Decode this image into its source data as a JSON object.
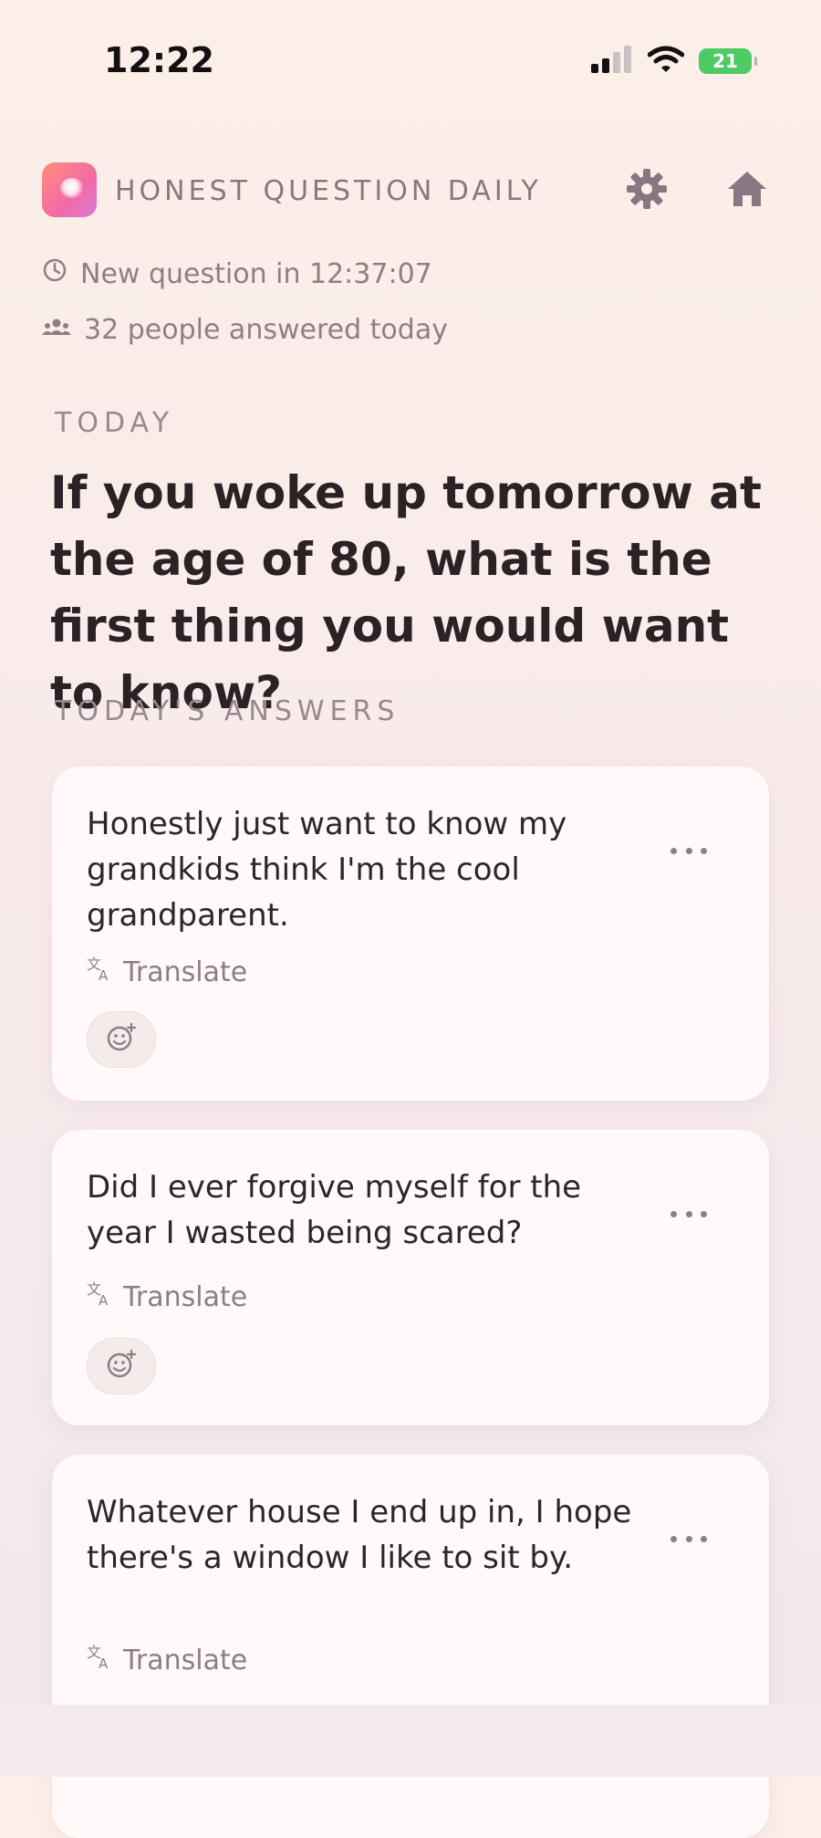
{
  "status_bar": {
    "time": "12:22",
    "battery": "21"
  },
  "header": {
    "title": "HONEST QUESTION DAILY"
  },
  "meta": {
    "countdown": "New question in 12:37:07",
    "answered": "32 people answered today"
  },
  "today": {
    "label": "TODAY",
    "question": "If you woke up tomorrow at the age of 80, what is the first thing you would want to know?"
  },
  "answers": {
    "label": "TODAY'S ANSWERS",
    "translate_label": "Translate",
    "items": [
      {
        "text": "Honestly just want to know my grandkids think I'm the cool grandparent."
      },
      {
        "text": "Did I ever forgive myself for the year I wasted being scared?"
      },
      {
        "text": "Whatever house I end up in, I hope there's a window I like to sit by."
      }
    ]
  },
  "colors": {
    "accent": "#8a7681",
    "logo_gradient": [
      "#ff8d7a",
      "#f36aa6",
      "#d97bd4"
    ],
    "battery": "#4ecb62"
  },
  "icons": [
    "signal-icon",
    "wifi-icon",
    "battery-icon",
    "app-logo",
    "gear-icon",
    "home-icon",
    "clock-icon",
    "people-icon",
    "more-icon",
    "translate-icon",
    "add-reaction-icon"
  ]
}
